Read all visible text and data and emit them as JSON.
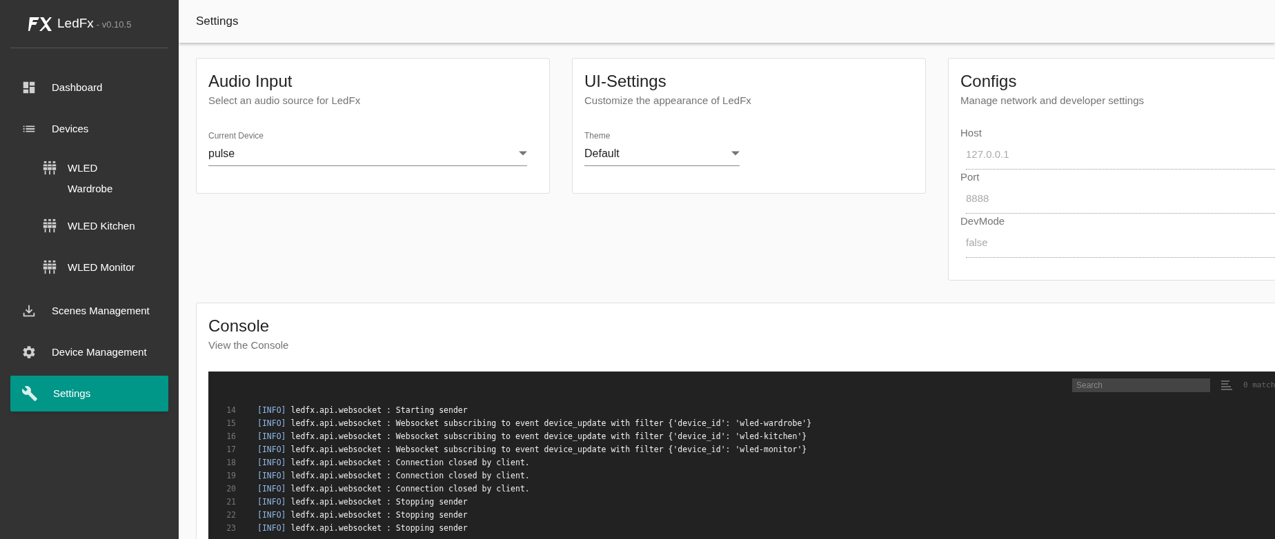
{
  "brand": {
    "name": "LedFx",
    "version": "- v0.10.5"
  },
  "nav": [
    {
      "label": "Dashboard",
      "selected": false
    },
    {
      "label": "Devices",
      "selected": false,
      "children": [
        {
          "label": "WLED Wardrobe",
          "selected": false
        },
        {
          "label": "WLED Kitchen",
          "selected": false
        },
        {
          "label": "WLED Monitor",
          "selected": false
        }
      ]
    },
    {
      "label": "Scenes Management",
      "selected": false
    },
    {
      "label": "Device Management",
      "selected": false
    },
    {
      "label": "Settings",
      "selected": true
    }
  ],
  "header": {
    "title": "Settings"
  },
  "audio_input": {
    "title": "Audio Input",
    "subtitle": "Select an audio source for LedFx",
    "field_label": "Current Device",
    "value": "pulse"
  },
  "ui_settings": {
    "title": "UI-Settings",
    "subtitle": "Customize the appearance of LedFx",
    "field_label": "Theme",
    "value": "Default"
  },
  "configs": {
    "title": "Configs",
    "subtitle": "Manage network and developer settings",
    "fields": [
      {
        "label": "Host",
        "placeholder": "127.0.0.1"
      },
      {
        "label": "Port",
        "placeholder": "8888"
      },
      {
        "label": "DevMode",
        "placeholder": "false"
      }
    ]
  },
  "console": {
    "title": "Console",
    "subtitle": "View the Console",
    "search_placeholder": "Search",
    "matches": "0 match",
    "lines": [
      {
        "n": "14",
        "tag": "[INFO]",
        "text": "ledfx.api.websocket : Starting sender"
      },
      {
        "n": "15",
        "tag": "[INFO]",
        "text": "ledfx.api.websocket : Websocket subscribing to event device_update with filter {'device_id': 'wled-wardrobe'}"
      },
      {
        "n": "16",
        "tag": "[INFO]",
        "text": "ledfx.api.websocket : Websocket subscribing to event device_update with filter {'device_id': 'wled-kitchen'}"
      },
      {
        "n": "17",
        "tag": "[INFO]",
        "text": "ledfx.api.websocket : Websocket subscribing to event device_update with filter {'device_id': 'wled-monitor'}"
      },
      {
        "n": "18",
        "tag": "[INFO]",
        "text": "ledfx.api.websocket : Connection closed by client."
      },
      {
        "n": "19",
        "tag": "[INFO]",
        "text": "ledfx.api.websocket : Connection closed by client."
      },
      {
        "n": "20",
        "tag": "[INFO]",
        "text": "ledfx.api.websocket : Connection closed by client."
      },
      {
        "n": "21",
        "tag": "[INFO]",
        "text": "ledfx.api.websocket : Stopping sender"
      },
      {
        "n": "22",
        "tag": "[INFO]",
        "text": "ledfx.api.websocket : Stopping sender"
      },
      {
        "n": "23",
        "tag": "[INFO]",
        "text": "ledfx.api.websocket : Stopping sender"
      }
    ]
  }
}
